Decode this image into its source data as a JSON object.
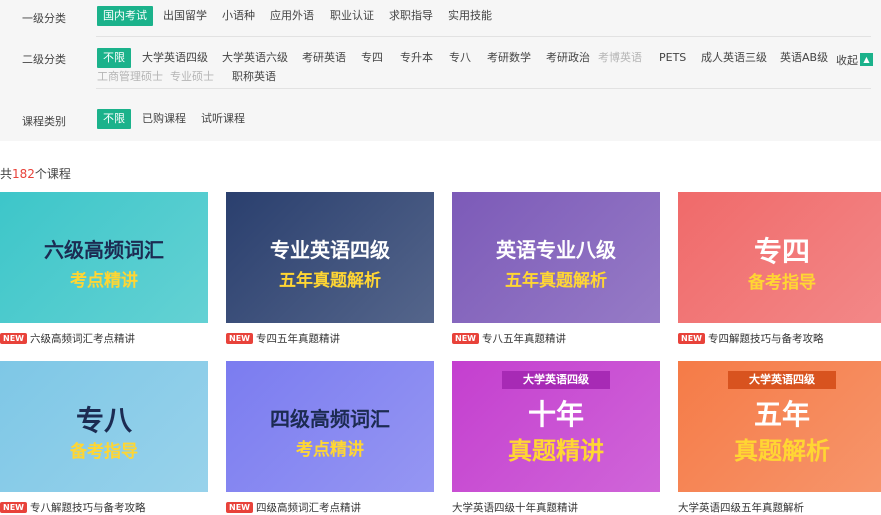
{
  "filters": {
    "level1": {
      "label": "一级分类",
      "options": [
        "国内考试",
        "出国留学",
        "小语种",
        "应用外语",
        "职业认证",
        "求职指导",
        "实用技能"
      ],
      "active": "国内考试"
    },
    "level2": {
      "label": "二级分类",
      "options_row1": [
        "不限",
        "大学英语四级",
        "大学英语六级",
        "考研英语",
        "专四",
        "专升本",
        "专八",
        "考研数学",
        "考研政治",
        "考博英语",
        "PETS",
        "成人英语三级",
        "英语AB级"
      ],
      "options_row2": [
        "工商管理硕士",
        "专业硕士",
        "职称英语"
      ],
      "disabled": [
        "考博英语",
        "工商管理硕士",
        "专业硕士"
      ],
      "active": "不限",
      "collapse_label": "收起",
      "collapse_icon": "chevron-up-icon"
    },
    "course_type": {
      "label": "课程类别",
      "options": [
        "不限",
        "已购课程",
        "试听课程"
      ],
      "active": "不限"
    }
  },
  "result_count": {
    "prefix": "共",
    "number": "182",
    "suffix": "个课程"
  },
  "courses": [
    {
      "title": "六级高频词汇考点精讲",
      "is_new": true,
      "thumb_line1": "六级高频词汇",
      "thumb_line2": "考点精讲",
      "thumb_bg": "#3dc6c9"
    },
    {
      "title": "专四五年真题精讲",
      "is_new": true,
      "thumb_line1": "专业英语四级",
      "thumb_line2": "五年真题解析",
      "thumb_bg": "#2a3f6e"
    },
    {
      "title": "专八五年真题精讲",
      "is_new": true,
      "thumb_line1": "英语专业八级",
      "thumb_line2": "五年真题解析",
      "thumb_bg": "#7c5ab8"
    },
    {
      "title": "专四解题技巧与备考攻略",
      "is_new": true,
      "thumb_line1": "专四",
      "thumb_line2": "备考指导",
      "thumb_bg": "#f06a6a"
    },
    {
      "title": "专八解题技巧与备考攻略",
      "is_new": true,
      "thumb_line1": "专八",
      "thumb_line2": "备考指导",
      "thumb_bg": "#7ec7e6"
    },
    {
      "title": "四级高频词汇考点精讲",
      "is_new": true,
      "thumb_line1": "四级高频词汇",
      "thumb_line2": "考点精讲",
      "thumb_bg": "#7b7cf0"
    },
    {
      "title": "大学英语四级十年真题精讲",
      "is_new": false,
      "thumb_tag": "大学英语四级",
      "thumb_line1": "十年",
      "thumb_line2": "真题精讲",
      "thumb_bg": "#c43fcf"
    },
    {
      "title": "大学英语四级五年真题解析",
      "is_new": false,
      "thumb_tag": "大学英语四级",
      "thumb_line1": "五年",
      "thumb_line2": "真题解析",
      "thumb_bg": "#f57b47"
    }
  ],
  "new_badge_label": "NEW"
}
